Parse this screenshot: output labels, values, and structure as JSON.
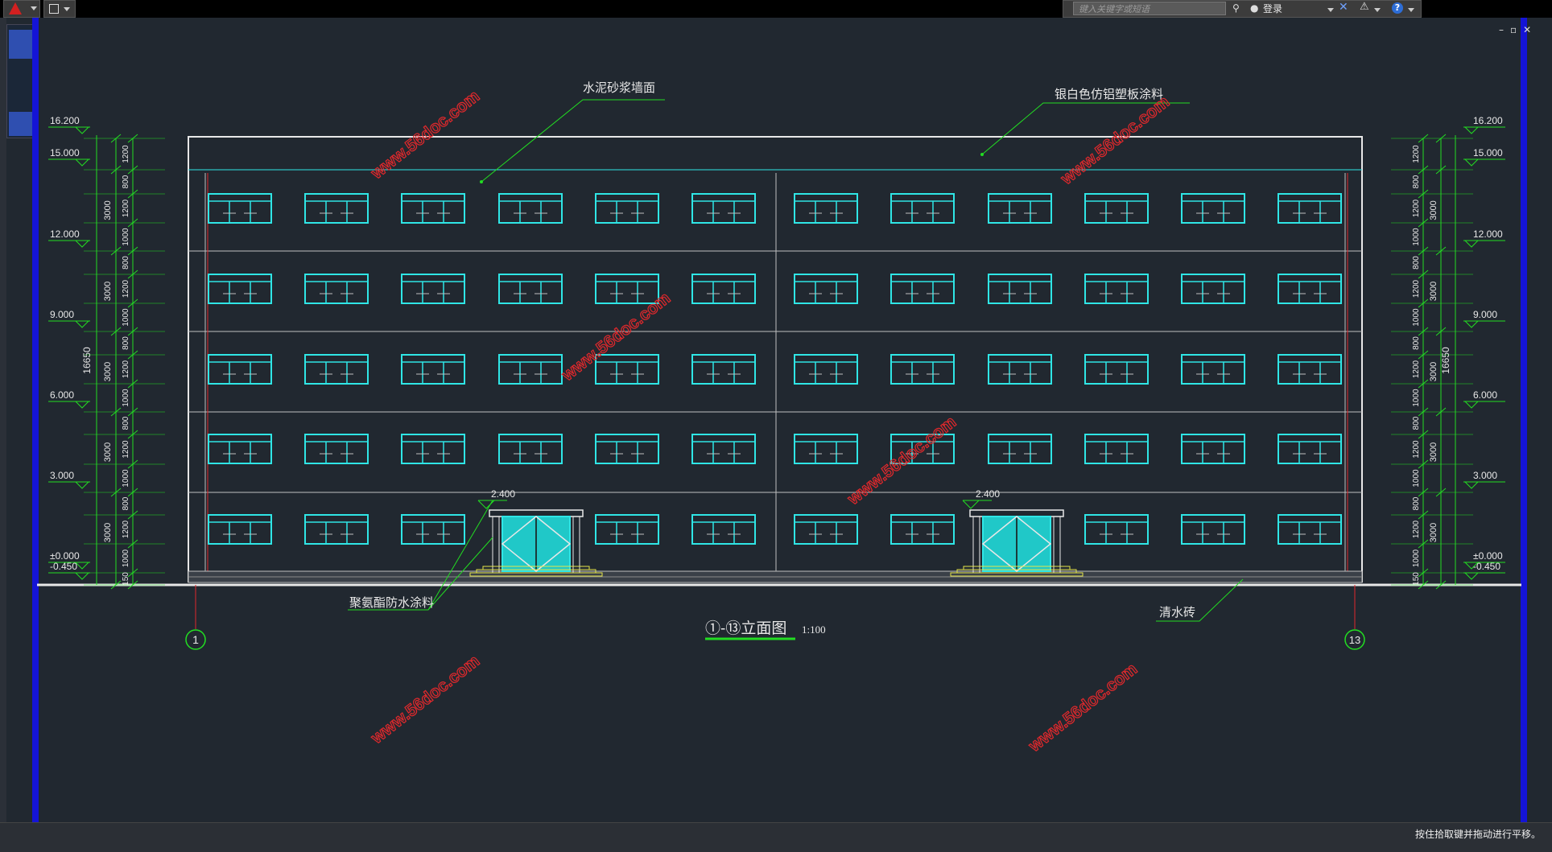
{
  "titlebar": {
    "search_placeholder": "键入关键字或短语",
    "login_label": "登录"
  },
  "drawing": {
    "elevation_title": "①-⑬立面图",
    "scale": "1:100",
    "axis_left": "1",
    "axis_right": "13",
    "callouts": {
      "cement_mortar": "水泥砂浆墙面",
      "silver_coating": "银白色仿铝塑板涂料",
      "polyurethane": "聚氨酯防水涂料",
      "clear_brick": "清水砖"
    },
    "entrance_label": "2.400",
    "level_marks": [
      "16.200",
      "15.000",
      "12.000",
      "9.000",
      "6.000",
      "3.000",
      "±0.000",
      "-0.450"
    ],
    "overall_dim": "16650",
    "floor_dims": [
      "3000",
      "3000",
      "3000",
      "3000",
      "3000"
    ],
    "window_dims": [
      "1200",
      "800",
      "1200",
      "1000",
      "800",
      "1200",
      "1000",
      "800",
      "1200",
      "1000",
      "800",
      "1200",
      "1000",
      "800",
      "1200",
      "1000",
      "150"
    ],
    "watermark": "www.56doc.com"
  },
  "statusbar": {
    "hint": "按住拾取键并拖动进行平移。"
  },
  "colors": {
    "canvas": "#212830",
    "cyan": "#2fe6e6",
    "green": "#22dd22",
    "white": "#e8e8e8",
    "watermark_red": "#e0282c",
    "yellow": "#e6e64a",
    "ribbon_blue": "#1414d6"
  }
}
